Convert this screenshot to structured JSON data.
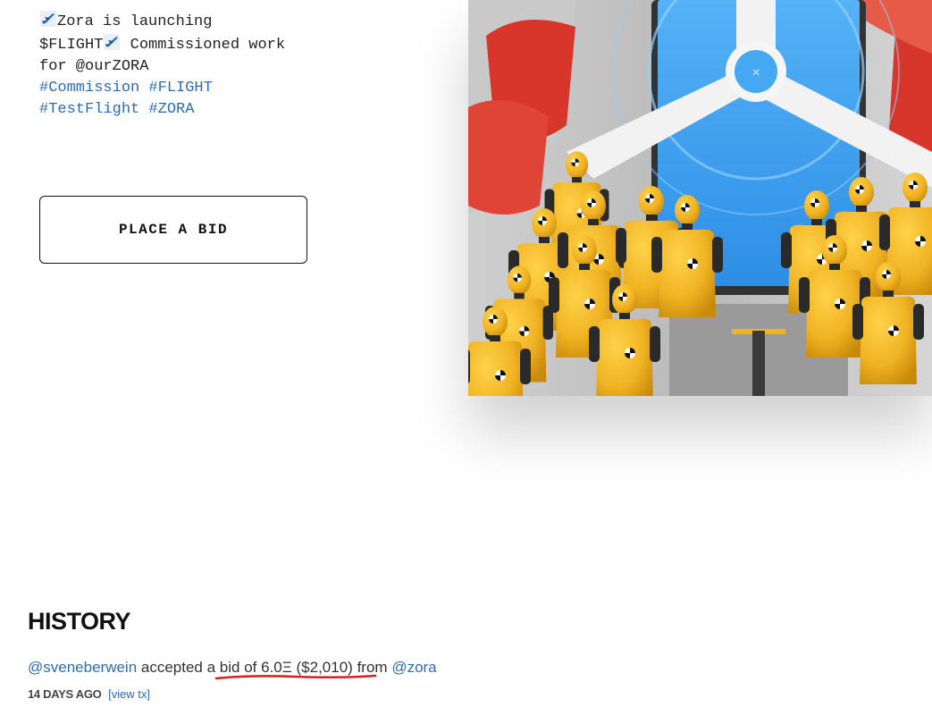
{
  "description": {
    "line1_text": "Zora is launching",
    "line2_start": "$FLIGHT",
    "line2_end": " Commissioned work",
    "line3": "for @ourZORA",
    "tags": [
      "#Commission",
      "#FLIGHT",
      "#TestFlight",
      "#ZORA"
    ]
  },
  "bid_button": {
    "label": "PLACE A BID"
  },
  "history": {
    "title": "HISTORY",
    "entry": {
      "user": "@sveneberwein",
      "action": "accepted",
      "bid": "a bid of 6.0Ξ ($2,010)",
      "from_word": "from",
      "bidder": "@zora",
      "time": "14 DAYS AGO",
      "view_tx": "[view tx]"
    }
  },
  "colors": {
    "link": "#2a6bb8",
    "annotation": "#d62020",
    "crash_dummy": "#f0b323",
    "screen": "#3d9ff0"
  }
}
